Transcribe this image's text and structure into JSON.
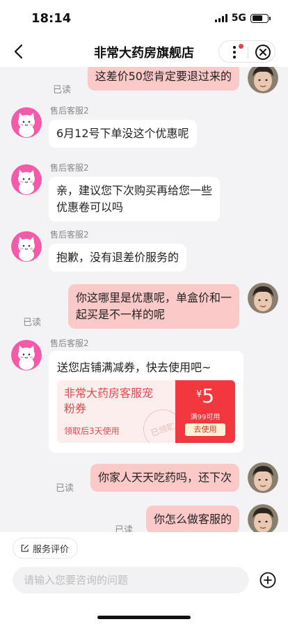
{
  "status_bar": {
    "time": "18:14",
    "network": "5G",
    "battery_level": 0.7
  },
  "navbar": {
    "title": "非常大药房旗舰店",
    "more_icon": "more-vertical-icon",
    "close_icon": "close-circle-icon"
  },
  "agent_name": "售后客服2",
  "read_label": "已读",
  "messages": [
    {
      "from": "user",
      "text": "这差价50您肯定要退过来的",
      "read": "已读"
    },
    {
      "from": "agent",
      "sender": "售后客服2",
      "text": "6月12号下单没这个优惠呢"
    },
    {
      "from": "agent",
      "sender": "售后客服2",
      "line1": "亲，建议您下次购买再给您一些",
      "line2": "优惠卷可以吗"
    },
    {
      "from": "agent",
      "sender": "售后客服2",
      "text": "抱歉，没有退差价服务的"
    },
    {
      "from": "user",
      "line1": "你这哪里是优惠呢，单盒价和一",
      "line2": "起买是不一样的呢",
      "read": "已读"
    },
    {
      "from": "agent",
      "sender": "售后客服2",
      "text": "送您店铺满减券，快去使用吧~"
    },
    {
      "from": "user",
      "text": "你家人天天吃药吗，还下次",
      "read": "已读"
    },
    {
      "from": "user",
      "text": "你怎么做客服的",
      "read": "已读"
    }
  ],
  "coupon": {
    "name_line1": "非常大药房客服宠",
    "name_line2": "粉券",
    "validity": "领取后3天使用",
    "stamp": "已领取",
    "currency": "¥",
    "amount": "5",
    "condition": "满99可用",
    "button": "去使用"
  },
  "bottom_bar": {
    "rate_label": "服务评价",
    "input_placeholder": "请输入您要咨询的问题",
    "input_value": ""
  },
  "colors": {
    "user_bubble": "#fbc9c7",
    "accent_red": "#f2373e",
    "agent_avatar": "#f45aa8"
  }
}
